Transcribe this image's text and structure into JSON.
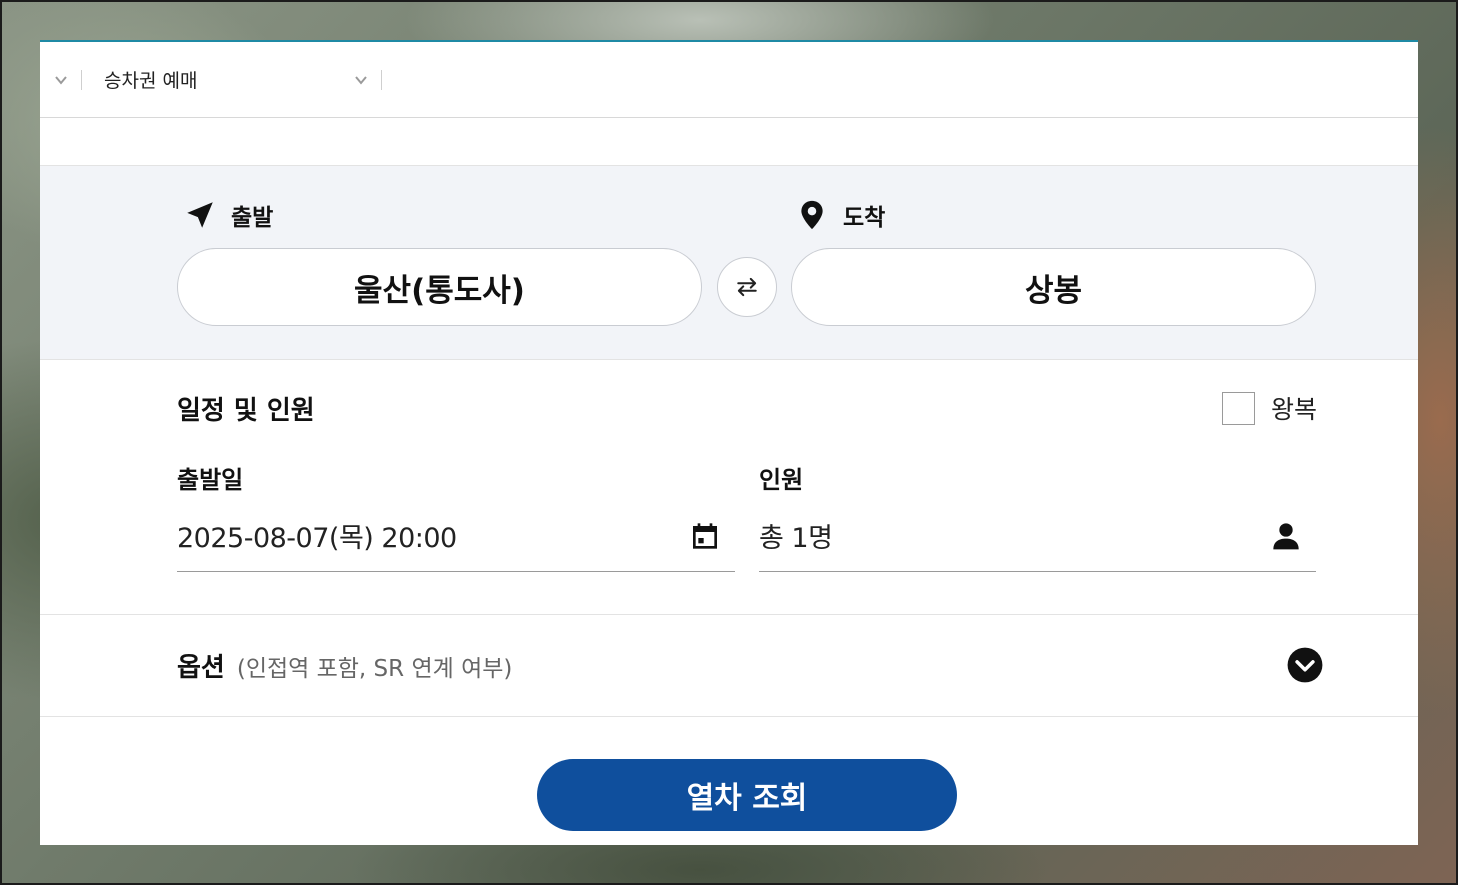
{
  "breadcrumb": {
    "items": [
      {
        "label": "승차권 예매"
      }
    ]
  },
  "route": {
    "departure_label": "출발",
    "arrival_label": "도착",
    "departure_station": "울산(통도사)",
    "arrival_station": "상봉"
  },
  "schedule": {
    "title": "일정 및 인원",
    "roundtrip_label": "왕복",
    "roundtrip_checked": false,
    "date_label": "출발일",
    "date_value": "2025-08-07(목) 20:00",
    "passengers_label": "인원",
    "passengers_value": "총 1명"
  },
  "options": {
    "title": "옵션",
    "subtitle": "(인접역 포함, SR 연계 여부)"
  },
  "search": {
    "label": "열차 조회"
  },
  "colors": {
    "accent_line": "#1f8aa5",
    "primary_button": "#0f4f9d",
    "station_bg": "#f2f4f8"
  }
}
